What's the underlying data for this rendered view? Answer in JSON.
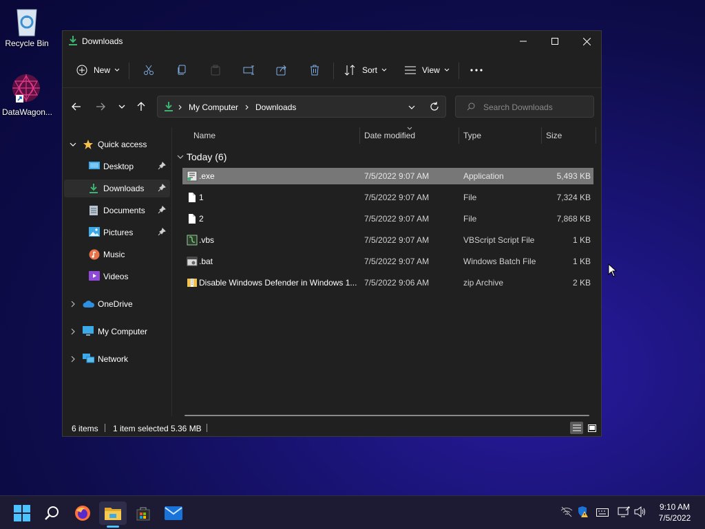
{
  "desktop": {
    "icons": [
      {
        "label": "Recycle Bin"
      },
      {
        "label": "DataWagon..."
      }
    ]
  },
  "window": {
    "title": "Downloads",
    "toolbar": {
      "new_label": "New",
      "sort_label": "Sort",
      "view_label": "View"
    },
    "address": {
      "crumbs": [
        "My Computer",
        "Downloads"
      ],
      "search_placeholder": "Search Downloads"
    },
    "nav": {
      "quick_access": "Quick access",
      "items": [
        {
          "label": "Desktop",
          "pinned": true,
          "icon": "desktop-icon"
        },
        {
          "label": "Downloads",
          "pinned": true,
          "icon": "downloads-icon",
          "selected": true
        },
        {
          "label": "Documents",
          "pinned": true,
          "icon": "documents-icon"
        },
        {
          "label": "Pictures",
          "pinned": true,
          "icon": "pictures-icon"
        },
        {
          "label": "Music",
          "pinned": false,
          "icon": "music-icon"
        },
        {
          "label": "Videos",
          "pinned": false,
          "icon": "videos-icon"
        }
      ],
      "roots": [
        {
          "label": "OneDrive",
          "icon": "onedrive-icon"
        },
        {
          "label": "My Computer",
          "icon": "computer-icon"
        },
        {
          "label": "Network",
          "icon": "network-icon"
        }
      ]
    },
    "columns": [
      "Name",
      "Date modified",
      "Type",
      "Size"
    ],
    "group": "Today (6)",
    "files": [
      {
        "name": ".exe",
        "date": "7/5/2022 9:07 AM",
        "type": "Application",
        "size": "5,493 KB",
        "icon": "exe-icon",
        "selected": true
      },
      {
        "name": "1",
        "date": "7/5/2022 9:07 AM",
        "type": "File",
        "size": "7,324 KB",
        "icon": "file-icon"
      },
      {
        "name": "2",
        "date": "7/5/2022 9:07 AM",
        "type": "File",
        "size": "7,868 KB",
        "icon": "file-icon"
      },
      {
        "name": ".vbs",
        "date": "7/5/2022 9:07 AM",
        "type": "VBScript Script File",
        "size": "1 KB",
        "icon": "vbs-icon"
      },
      {
        "name": ".bat",
        "date": "7/5/2022 9:07 AM",
        "type": "Windows Batch File",
        "size": "1 KB",
        "icon": "bat-icon"
      },
      {
        "name": "Disable Windows Defender in Windows 1...",
        "date": "7/5/2022 9:06 AM",
        "type": "zip Archive",
        "size": "2 KB",
        "icon": "zip-icon"
      }
    ],
    "status": {
      "items": "6 items",
      "selected": "1 item selected",
      "size": "5.36 MB"
    }
  },
  "taskbar": {
    "time": "9:10 AM",
    "date": "7/5/2022"
  },
  "colors": {
    "accent": "#0078d4",
    "download_green": "#3cb371",
    "folder_yellow": "#f2c14e"
  }
}
